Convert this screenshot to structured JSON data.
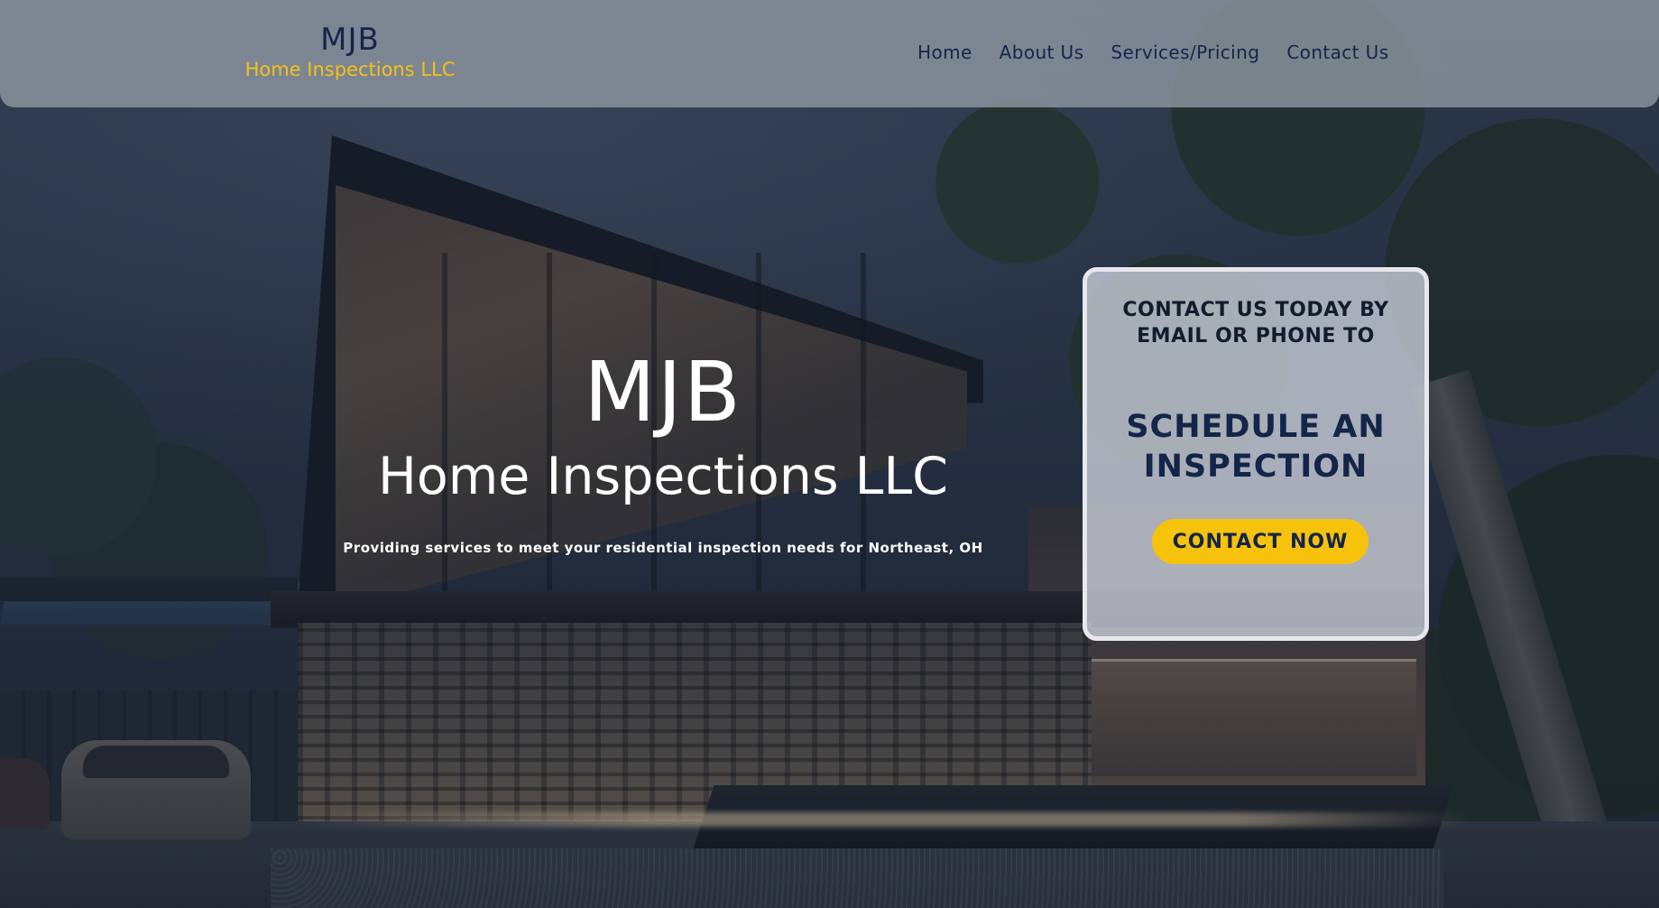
{
  "header": {
    "logo_title": "MJB",
    "logo_subtitle": "Home Inspections LLC",
    "nav": [
      {
        "label": "Home"
      },
      {
        "label": "About Us"
      },
      {
        "label": "Services/Pricing"
      },
      {
        "label": "Contact Us"
      }
    ]
  },
  "hero": {
    "title": "MJB",
    "subtitle": "Home Inspections LLC",
    "tagline": "Providing services to meet your residential inspection needs for Northeast, OH"
  },
  "cta": {
    "intro": "CONTACT US TODAY BY EMAIL OR PHONE TO",
    "headline": "SCHEDULE AN INSPECTION",
    "button_label": "CONTACT NOW"
  },
  "colors": {
    "brand_navy": "#14254a",
    "brand_gold": "#f5c116",
    "header_bg": "#8c96a0",
    "button_bg": "#f7c20c"
  }
}
